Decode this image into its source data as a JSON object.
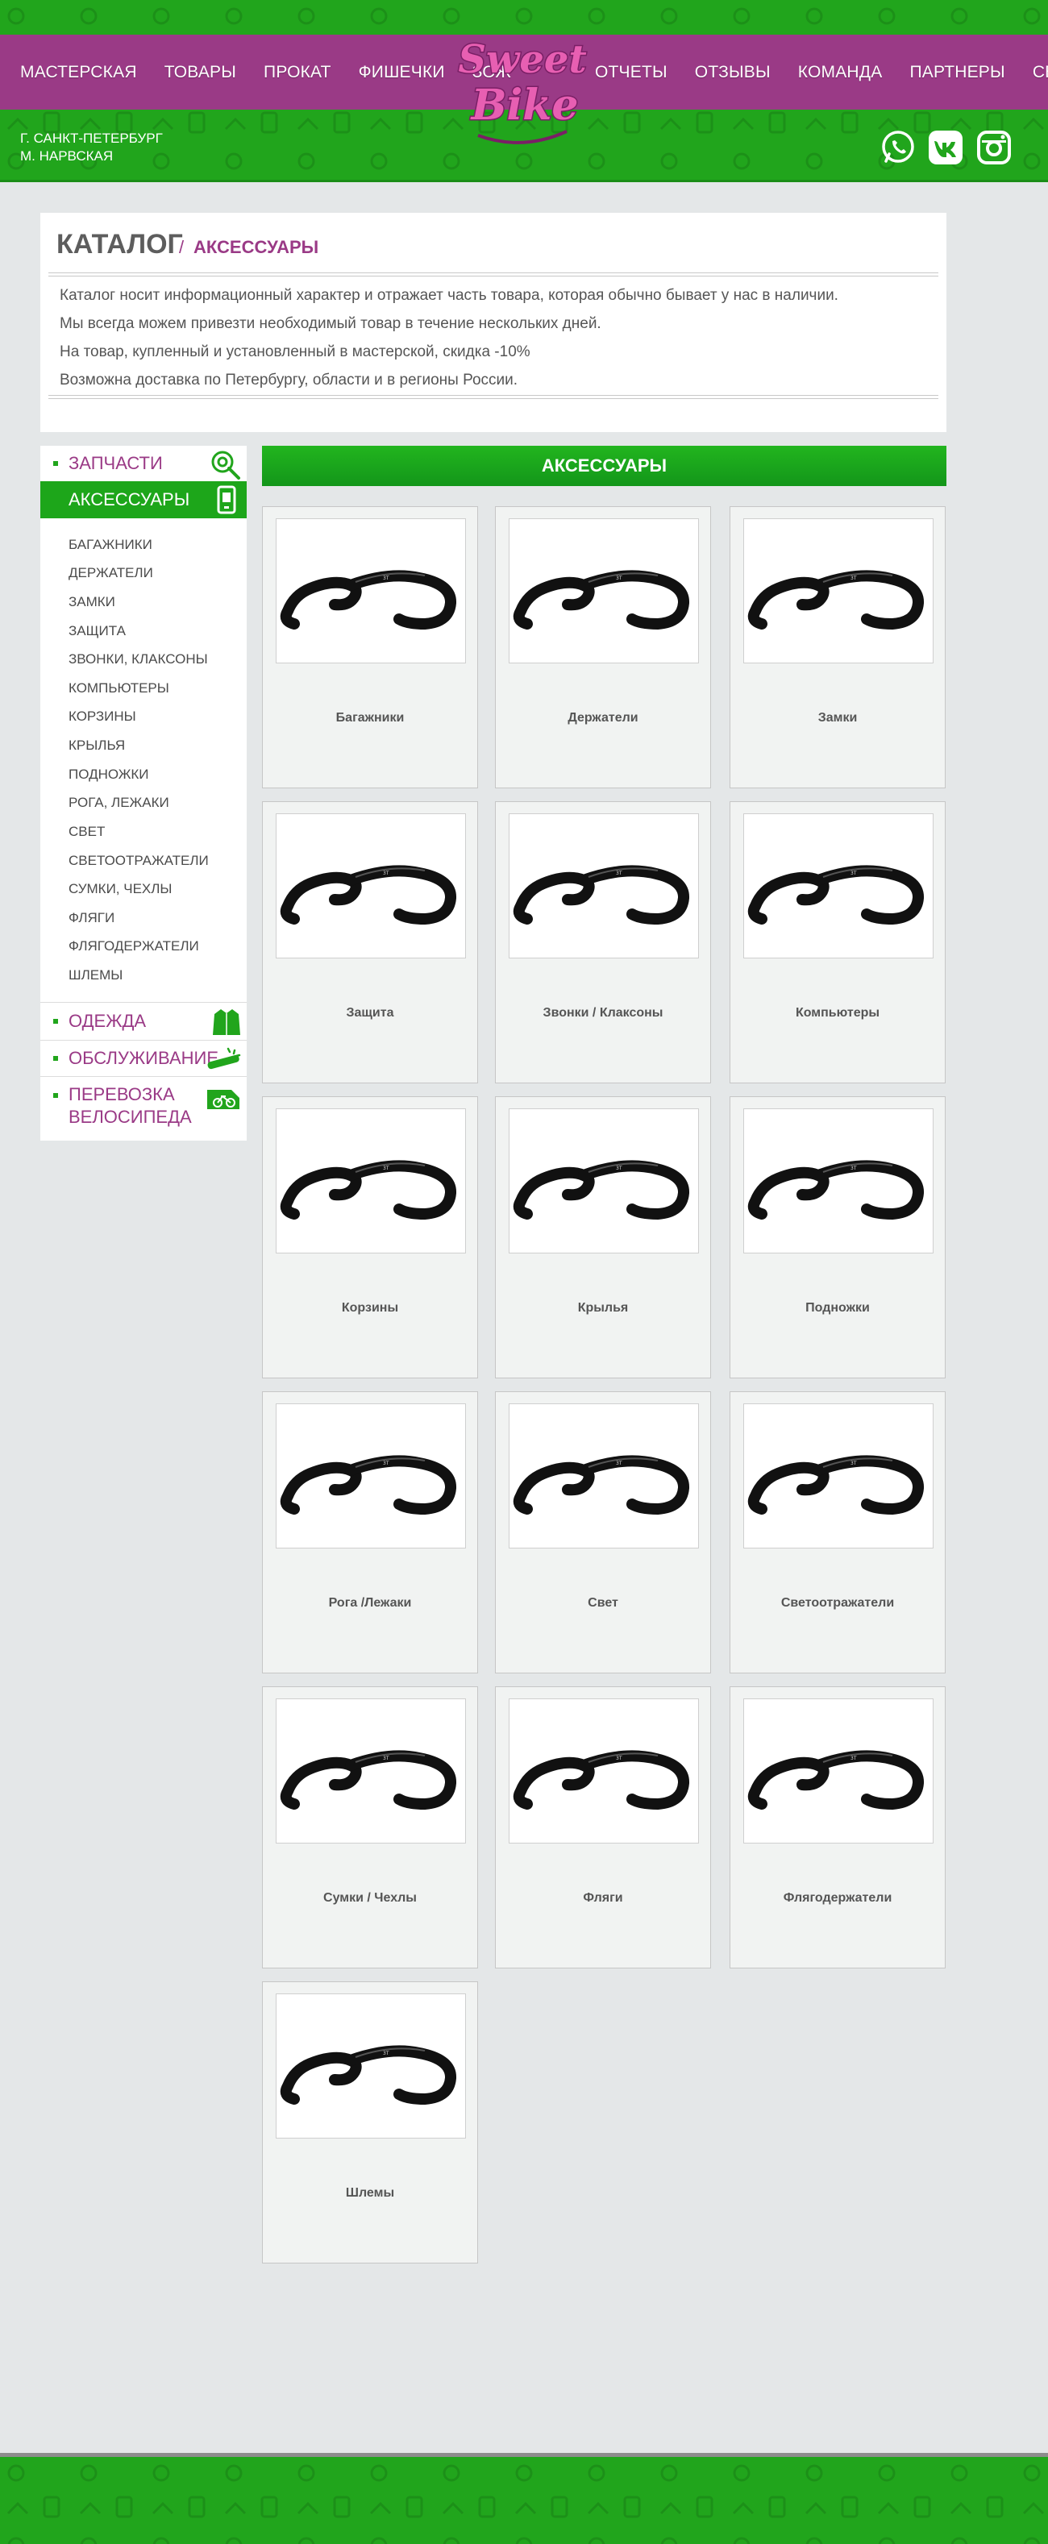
{
  "header": {
    "nav_left": [
      "МАСТЕРСКАЯ",
      "ТОВАРЫ",
      "ПРОКАТ",
      "ФИШЕЧКИ",
      "ЗОЖ"
    ],
    "nav_right": [
      "ОТЧЕТЫ",
      "ОТЗЫВЫ",
      "КОМАНДА",
      "ПАРТНЕРЫ",
      "СВЯЗЬ"
    ],
    "logo_text": [
      "Sweet",
      "Bike"
    ],
    "city_line1": "Г. САНКТ-ПЕТЕРБУРГ",
    "city_line2": "М. НАРВСКАЯ",
    "social_icons": [
      "whatsapp-icon",
      "vk-icon",
      "instagram-icon"
    ]
  },
  "catalog": {
    "title": "КАТАЛОГ",
    "separator": "/",
    "breadcrumb": "АКСЕССУАРЫ",
    "info": [
      "Каталог носит информационный характер и отражает часть товара, которая обычно бывает у нас в наличии.",
      "Мы всегда можем привезти необходимый товар в течение нескольких дней.",
      "На товар, купленный и установленный в мастерской, скидка -10%",
      "Возможна доставка по Петербургу, области и в регионы России."
    ]
  },
  "sidebar": {
    "cat_parts": "ЗАПЧАСТИ",
    "cat_accessories": "АКСЕССУАРЫ",
    "subcategories": [
      "БАГАЖНИКИ",
      "ДЕРЖАТЕЛИ",
      "ЗАМКИ",
      "ЗАЩИТА",
      "ЗВОНКИ, КЛАКСОНЫ",
      "КОМПЬЮТЕРЫ",
      "КОРЗИНЫ",
      "КРЫЛЬЯ",
      "ПОДНОЖКИ",
      "РОГА, ЛЕЖАКИ",
      "СВЕТ",
      "СВЕТООТРАЖАТЕЛИ",
      "СУМКИ, ЧЕХЛЫ",
      "ФЛЯГИ",
      "ФЛЯГОДЕРЖАТЕЛИ",
      "ШЛЕМЫ"
    ],
    "cat_clothes": "ОДЕЖДА",
    "cat_service": "ОБСЛУЖИВАНИЕ",
    "cat_transport_1": "ПЕРЕВОЗКА",
    "cat_transport_2": "ВЕЛОСИПЕДА"
  },
  "content": {
    "header": "АКСЕССУАРЫ",
    "products": [
      "Багажники",
      "Держатели",
      "Замки",
      "Защита",
      "Звонки / Клаксоны",
      "Компьютеры",
      "Корзины",
      "Крылья",
      "Подножки",
      "Рога /Лежаки",
      "Свет",
      "Светоотражатели",
      "Сумки / Чехлы",
      "Фляги",
      "Флягодержатели",
      "Шлемы"
    ]
  },
  "colors": {
    "green": "#21a51c",
    "purple": "#9a3a86",
    "background": "#e4e7e8"
  }
}
